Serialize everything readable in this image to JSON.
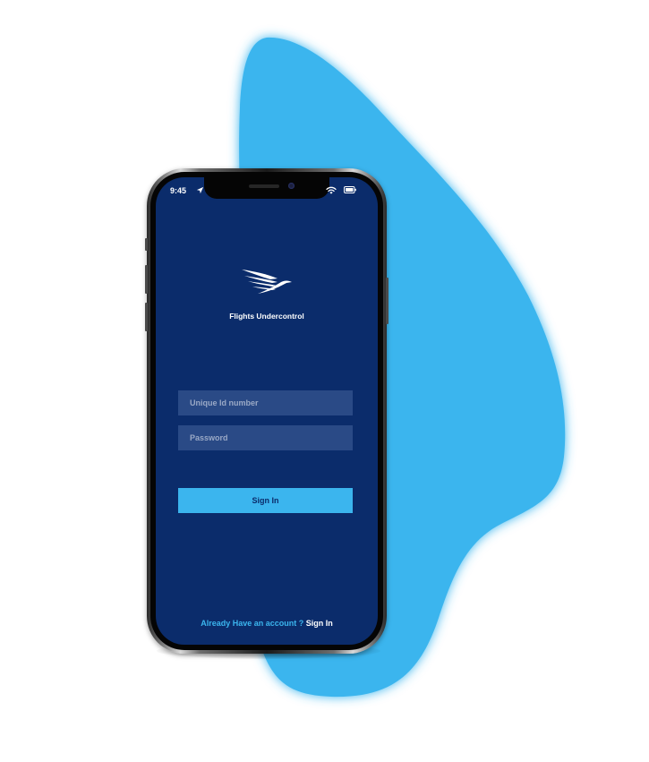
{
  "status_bar": {
    "time": "9:45",
    "icons": [
      "location-arrow-icon",
      "wifi-icon",
      "battery-icon"
    ]
  },
  "brand": {
    "logo_icon": "bird-wing-logo-icon",
    "name": "Flights Undercontrol"
  },
  "form": {
    "unique_id_placeholder": "Unique Id number",
    "password_placeholder": "Password",
    "submit_label": "Sign In"
  },
  "footer": {
    "prompt": "Already Have an account ?",
    "link": "Sign In"
  },
  "colors": {
    "screen_background": "#0b2c6b",
    "input_background": "#2a4a86",
    "accent": "#3bb5ee",
    "blob": "#3bb5ee",
    "text_primary": "#ffffff"
  }
}
